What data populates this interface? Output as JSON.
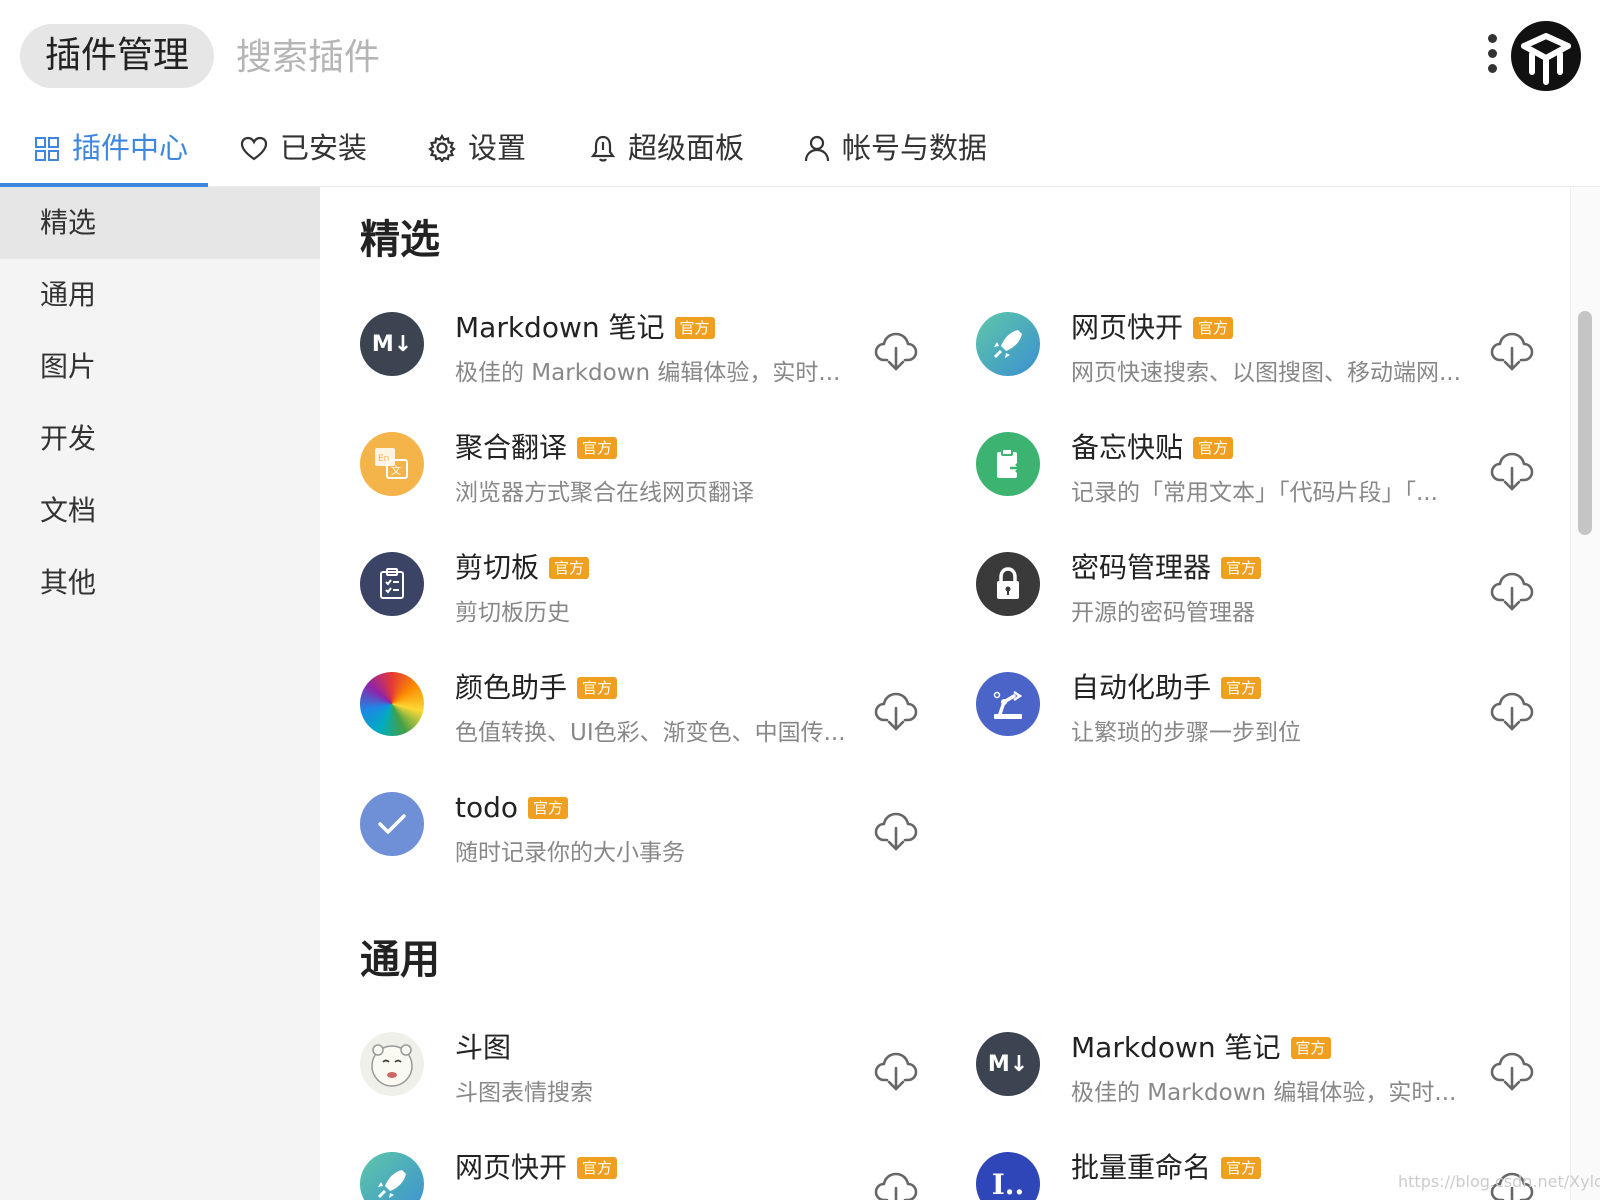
{
  "header": {
    "title": "插件管理",
    "search_placeholder": "搜索插件"
  },
  "tabs": [
    {
      "label": "插件中心",
      "icon": "grid-icon",
      "active": true
    },
    {
      "label": "已安装",
      "icon": "heart-icon",
      "active": false
    },
    {
      "label": "设置",
      "icon": "gear-icon",
      "active": false
    },
    {
      "label": "超级面板",
      "icon": "bell-icon",
      "active": false
    },
    {
      "label": "帐号与数据",
      "icon": "user-icon",
      "active": false
    }
  ],
  "sidebar": {
    "items": [
      {
        "label": "精选",
        "active": true
      },
      {
        "label": "通用",
        "active": false
      },
      {
        "label": "图片",
        "active": false
      },
      {
        "label": "开发",
        "active": false
      },
      {
        "label": "文档",
        "active": false
      },
      {
        "label": "其他",
        "active": false
      }
    ]
  },
  "sections": [
    {
      "title": "精选",
      "plugins": [
        {
          "name": "Markdown 笔记",
          "official": true,
          "badge": "官方",
          "desc": "极佳的 Markdown 编辑体验，实时...",
          "icon": "markdown-icon"
        },
        {
          "name": "网页快开",
          "official": true,
          "badge": "官方",
          "desc": "网页快速搜索、以图搜图、移动端网...",
          "icon": "rocket-icon"
        },
        {
          "name": "聚合翻译",
          "official": true,
          "badge": "官方",
          "desc": "浏览器方式聚合在线网页翻译",
          "icon": "translate-icon"
        },
        {
          "name": "备忘快贴",
          "official": true,
          "badge": "官方",
          "desc": "记录的「常用文本」「代码片段」「...",
          "icon": "clipboard-paste-icon"
        },
        {
          "name": "剪切板",
          "official": true,
          "badge": "官方",
          "desc": "剪切板历史",
          "icon": "clipboard-list-icon"
        },
        {
          "name": "密码管理器",
          "official": true,
          "badge": "官方",
          "desc": "开源的密码管理器",
          "icon": "lock-icon"
        },
        {
          "name": "颜色助手",
          "official": true,
          "badge": "官方",
          "desc": "色值转换、UI色彩、渐变色、中国传...",
          "icon": "color-wheel-icon"
        },
        {
          "name": "自动化助手",
          "official": true,
          "badge": "官方",
          "desc": "让繁琐的步骤一步到位",
          "icon": "robot-arm-icon"
        },
        {
          "name": "todo",
          "official": true,
          "badge": "官方",
          "desc": "随时记录你的大小事务",
          "icon": "check-icon"
        }
      ]
    },
    {
      "title": "通用",
      "plugins": [
        {
          "name": "斗图",
          "official": false,
          "badge": "",
          "desc": "斗图表情搜索",
          "icon": "meme-face-icon"
        },
        {
          "name": "Markdown 笔记",
          "official": true,
          "badge": "官方",
          "desc": "极佳的 Markdown 编辑体验，实时...",
          "icon": "markdown-icon"
        },
        {
          "name": "网页快开",
          "official": true,
          "badge": "官方",
          "desc": "",
          "icon": "rocket-icon"
        },
        {
          "name": "批量重命名",
          "official": true,
          "badge": "官方",
          "desc": "",
          "icon": "rename-icon"
        }
      ]
    }
  ],
  "watermark": "https://blog.csdn.net/Xylon",
  "colors": {
    "accent": "#3f86e0",
    "badge": "#f0a020",
    "sidebar_bg": "#f4f4f4",
    "sidebar_active": "#e6e6e6"
  }
}
